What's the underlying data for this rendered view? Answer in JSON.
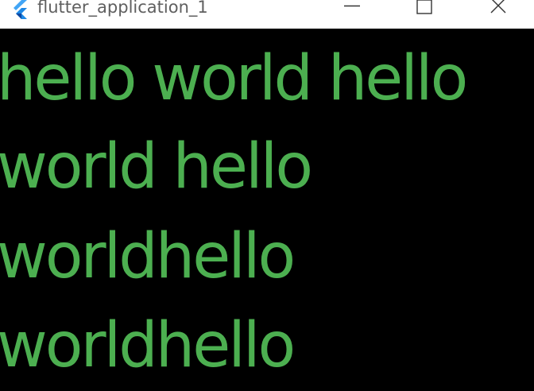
{
  "window": {
    "title": "flutter_application_1",
    "icon": "flutter-logo-icon",
    "controls": {
      "minimize_icon": "minimize-icon",
      "maximize_icon": "maximize-icon",
      "close_icon": "close-icon"
    }
  },
  "content": {
    "text_color": "#4caf50",
    "background_color": "#000000",
    "lines": [
      "hello world hello",
      "world hello",
      "worldhello",
      "worldhello"
    ]
  }
}
